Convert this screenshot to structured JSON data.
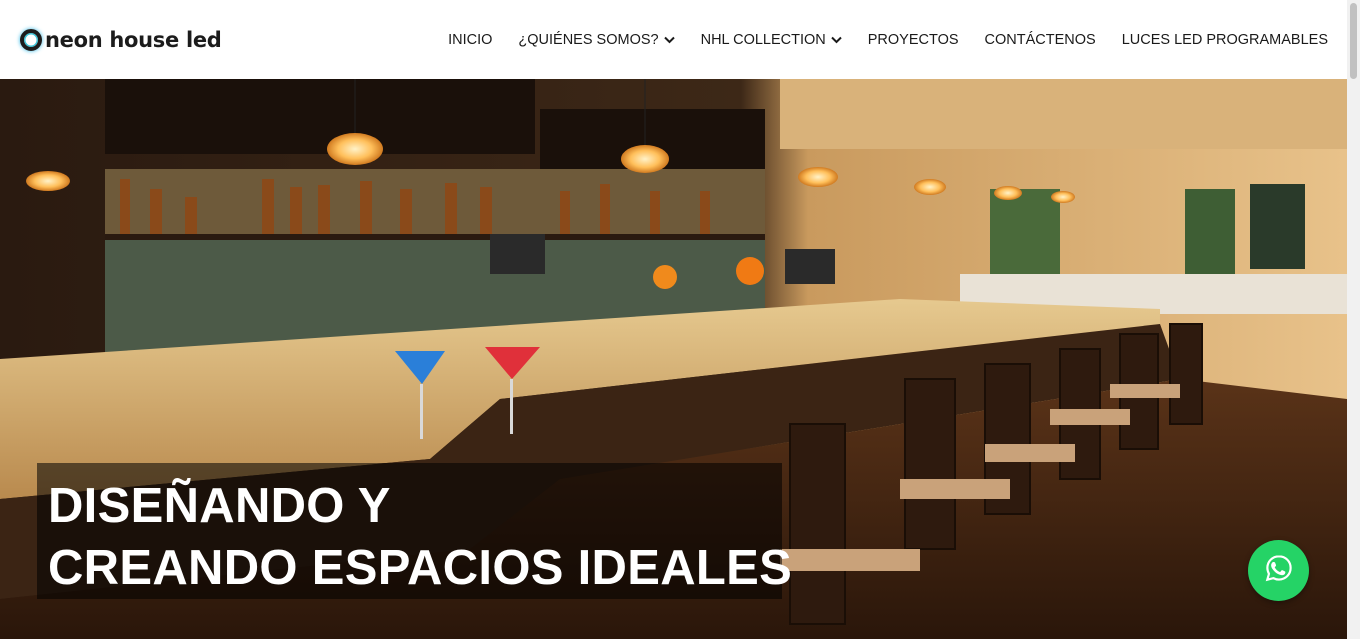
{
  "brand": {
    "logo_text": "neon house led"
  },
  "nav": {
    "items": [
      {
        "label": "INICIO",
        "has_dropdown": false
      },
      {
        "label": "¿QUIÉNES SOMOS?",
        "has_dropdown": true
      },
      {
        "label": "NHL COLLECTION",
        "has_dropdown": true
      },
      {
        "label": "PROYECTOS",
        "has_dropdown": false
      },
      {
        "label": "CONTÁCTENOS",
        "has_dropdown": false
      },
      {
        "label": "LUCES LED PROGRAMABLES",
        "has_dropdown": false
      }
    ]
  },
  "hero": {
    "headline_line1": "DISEÑANDO Y",
    "headline_line2": "CREANDO ESPACIOS IDEALES",
    "image_subject": "restaurant-bar-interior"
  },
  "whatsapp": {
    "icon": "whatsapp-icon",
    "color": "#25d366"
  },
  "colors": {
    "header_bg": "#ffffff",
    "nav_text": "#1a1a1a",
    "overlay": "rgba(0,0,0,0.55)"
  }
}
